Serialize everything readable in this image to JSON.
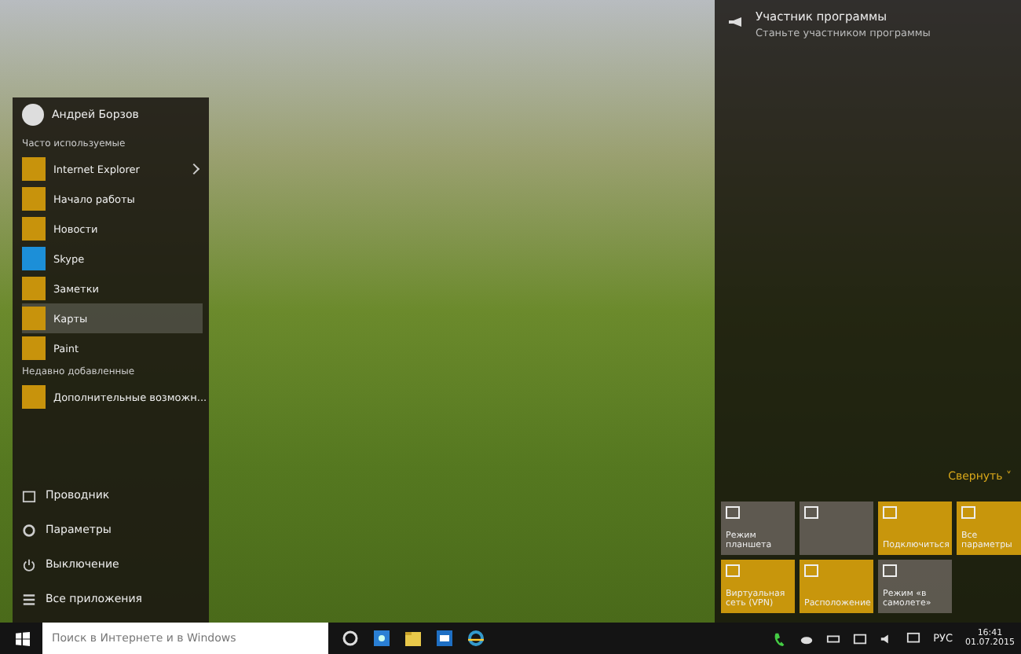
{
  "start_menu": {
    "user": "Андрей Борзов",
    "most_used_heading": "Часто используемые",
    "apps": [
      {
        "label": "Internet Explorer",
        "color": "#c8930c",
        "expandable": true,
        "selected": false
      },
      {
        "label": "Начало работы",
        "color": "#c8930c",
        "expandable": false,
        "selected": false
      },
      {
        "label": "Новости",
        "color": "#c8930c",
        "expandable": false,
        "selected": false
      },
      {
        "label": "Skype",
        "color": "#1c8fd8",
        "expandable": false,
        "selected": false
      },
      {
        "label": "Заметки",
        "color": "#c8930c",
        "expandable": false,
        "selected": false
      },
      {
        "label": "Карты",
        "color": "#c8930c",
        "expandable": false,
        "selected": true
      },
      {
        "label": "Paint",
        "color": "#c8930c",
        "expandable": false,
        "selected": false
      }
    ],
    "recent_heading": "Недавно добавленные",
    "recent": [
      {
        "label": "Дополнительные возможн...",
        "color": "#c8930c"
      }
    ],
    "places": [
      {
        "kind": "explorer",
        "label": "Проводник"
      },
      {
        "kind": "settings",
        "label": "Параметры"
      },
      {
        "kind": "power",
        "label": "Выключение"
      },
      {
        "kind": "apps",
        "label": "Все приложения"
      }
    ]
  },
  "action_center": {
    "notification": {
      "title": "Участник программы",
      "text": "Станьте участником программы"
    },
    "collapse": "Свернуть ˅",
    "tiles": [
      {
        "label": "Режим планшета",
        "on": false
      },
      {
        "on": false
      },
      {
        "label": "Подключиться",
        "on": true
      },
      {
        "label": "Все параметры",
        "on": true
      },
      {
        "label": "Виртуальная сеть (VPN)",
        "on": true
      },
      {
        "label": "Расположение",
        "on": true
      },
      {
        "label": "Режим «в самолете»",
        "on": false
      }
    ]
  },
  "taskbar": {
    "search": {
      "placeholder": "Поиск в Интернете и в Windows"
    },
    "language": "РУС",
    "time": "16:41",
    "date": "01.07.2015"
  }
}
